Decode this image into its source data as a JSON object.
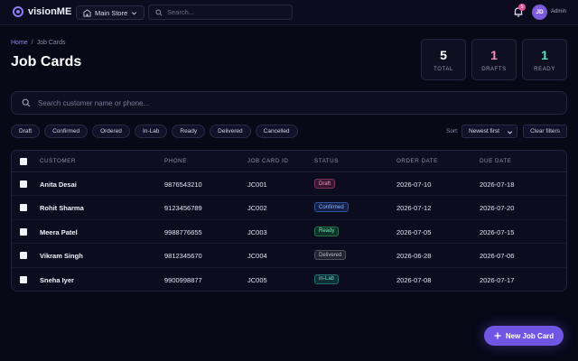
{
  "app": {
    "name": "visionME"
  },
  "topbar": {
    "store_label": "Main Store",
    "search_placeholder": "Search...",
    "notification_count": "5",
    "avatar_initials": "JD",
    "role": "Admin"
  },
  "breadcrumb": {
    "home": "Home",
    "separator": "/",
    "current": "Job Cards"
  },
  "page": {
    "title": "Job Cards"
  },
  "stats": {
    "total": {
      "value": "5",
      "label": "TOTAL"
    },
    "drafts": {
      "value": "1",
      "label": "DRAFTS"
    },
    "ready": {
      "value": "1",
      "label": "READY"
    }
  },
  "main_search": {
    "placeholder": "Search customer name or phone..."
  },
  "filters": [
    "Draft",
    "Confirmed",
    "Ordered",
    "In-Lab",
    "Ready",
    "Delivered",
    "Cancelled"
  ],
  "sort": {
    "label": "Sort:",
    "value": "Newest first"
  },
  "clear_filters": "Clear filters",
  "table": {
    "headers": [
      "CUSTOMER",
      "PHONE",
      "JOB CARD ID",
      "STATUS",
      "ORDER DATE",
      "DUE DATE"
    ],
    "rows": [
      {
        "customer": "Anita Desai",
        "phone": "9876543210",
        "id": "JC001",
        "status": "Draft",
        "order": "2026-07-10",
        "due": "2026-07-18"
      },
      {
        "customer": "Rohit Sharma",
        "phone": "9123456789",
        "id": "JC002",
        "status": "Confirmed",
        "order": "2026-07-12",
        "due": "2026-07-20"
      },
      {
        "customer": "Meera Patel",
        "phone": "9988776655",
        "id": "JC003",
        "status": "Ready",
        "order": "2026-07-05",
        "due": "2026-07-15"
      },
      {
        "customer": "Vikram Singh",
        "phone": "9812345670",
        "id": "JC004",
        "status": "Delivered",
        "order": "2026-06-28",
        "due": "2026-07-06"
      },
      {
        "customer": "Sneha Iyer",
        "phone": "9900998877",
        "id": "JC005",
        "status": "In-Lab",
        "order": "2026-07-08",
        "due": "2026-07-17"
      }
    ]
  },
  "status_colors": {
    "Draft": {
      "fg": "#f29ac8",
      "bg": "#3a1530",
      "border": "#7a3464"
    },
    "Confirmed": {
      "fg": "#8fb4ff",
      "bg": "#14224a",
      "border": "#34539a"
    },
    "Ready": {
      "fg": "#6be3b4",
      "bg": "#0f3326",
      "border": "#22704f"
    },
    "Delivered": {
      "fg": "#b8bccb",
      "bg": "#22242f",
      "border": "#4a4e5e"
    },
    "In-Lab": {
      "fg": "#5fe0d6",
      "bg": "#0e3034",
      "border": "#1f6f72"
    }
  },
  "fab": {
    "label": "New Job Card"
  },
  "colors": {
    "accent": "#7056e4",
    "background": "#080817"
  }
}
